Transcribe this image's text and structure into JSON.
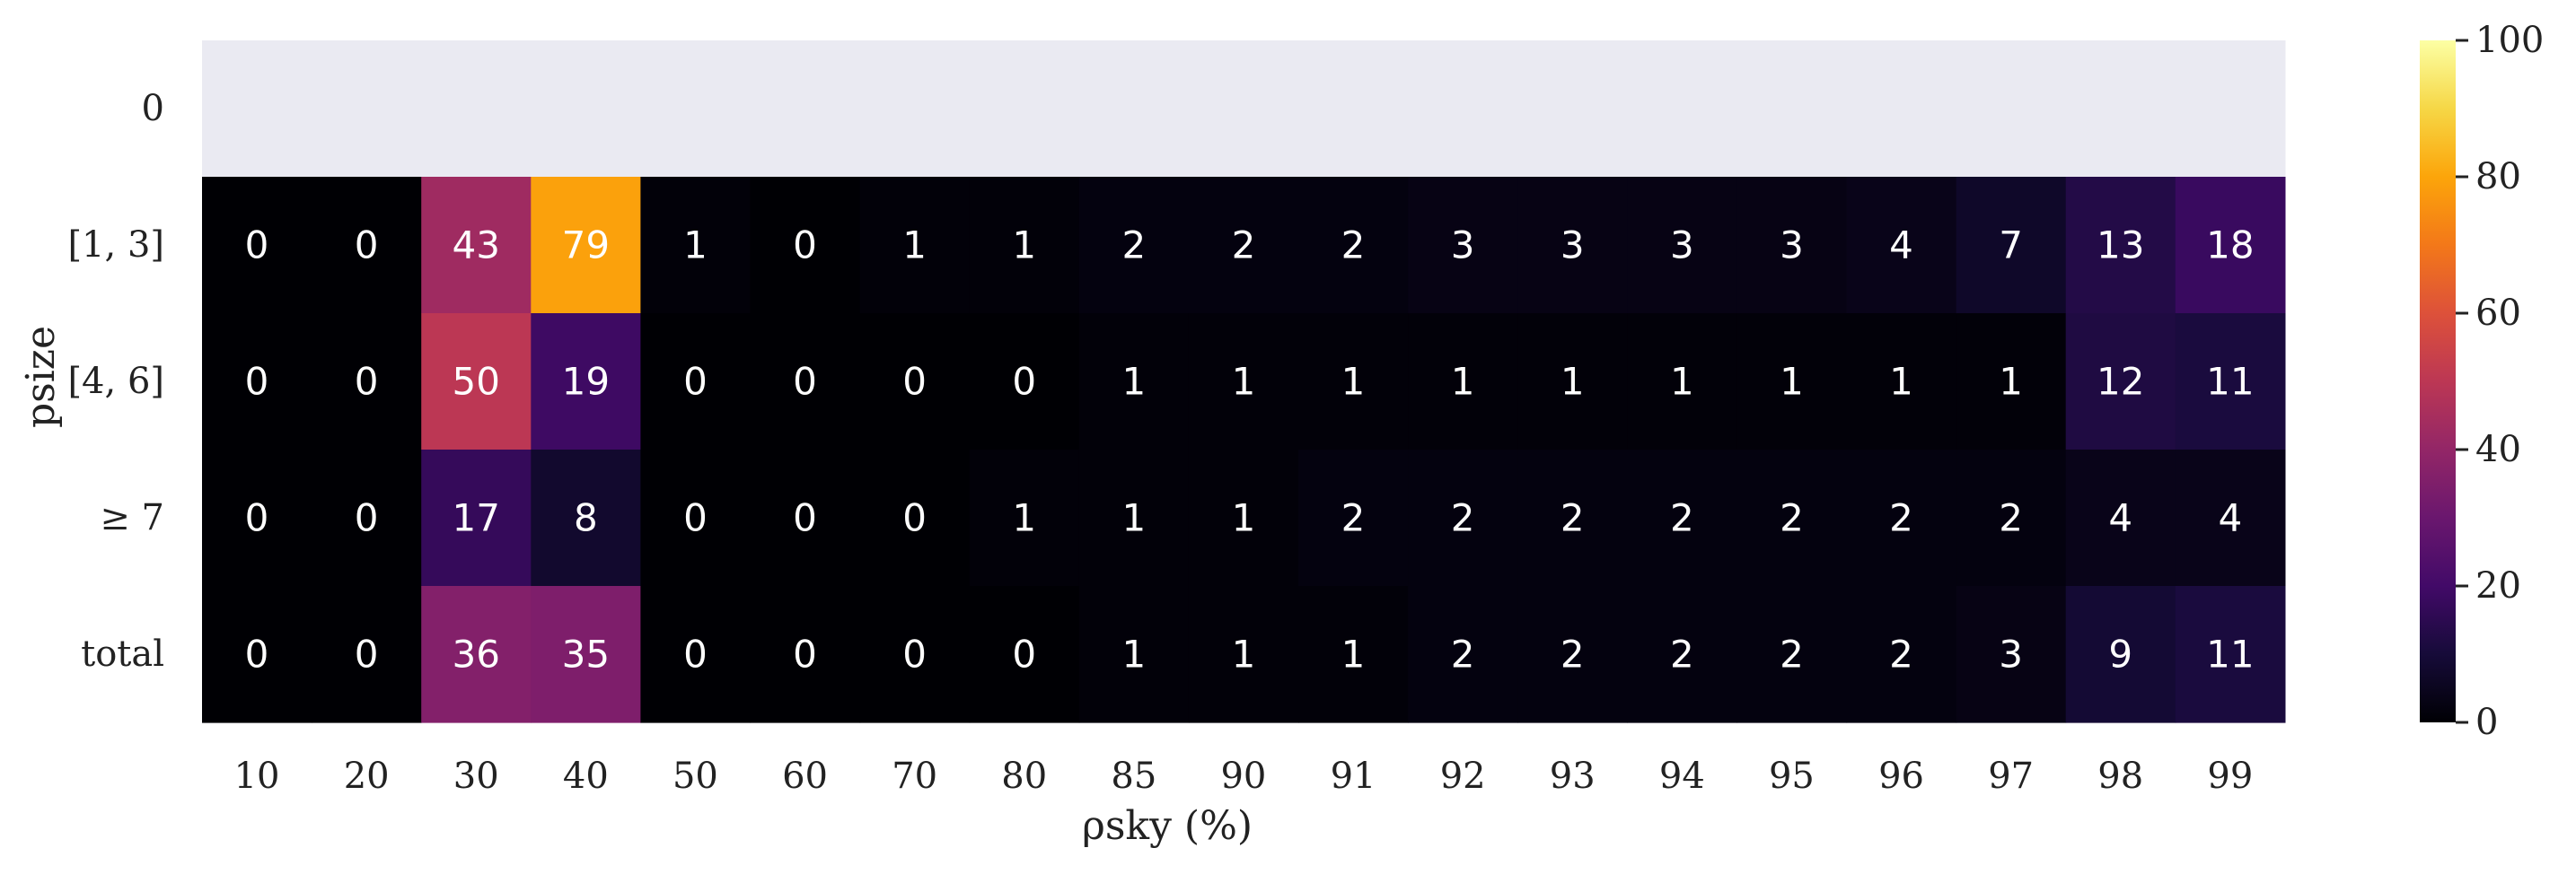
{
  "chart_data": {
    "type": "heatmap",
    "title": "",
    "xlabel": "ρsky (%)",
    "ylabel": "psize",
    "x_categories": [
      "10",
      "20",
      "30",
      "40",
      "50",
      "60",
      "70",
      "80",
      "85",
      "90",
      "91",
      "92",
      "93",
      "94",
      "95",
      "96",
      "97",
      "98",
      "99"
    ],
    "y_categories": [
      "0",
      "[1, 3]",
      "[4, 6]",
      "≥ 7",
      "total"
    ],
    "values": [
      [
        null,
        null,
        null,
        null,
        null,
        null,
        null,
        null,
        null,
        null,
        null,
        null,
        null,
        null,
        null,
        null,
        null,
        null,
        null
      ],
      [
        0,
        0,
        43,
        79,
        1,
        0,
        1,
        1,
        2,
        2,
        2,
        3,
        3,
        3,
        3,
        4,
        7,
        13,
        18
      ],
      [
        0,
        0,
        50,
        19,
        0,
        0,
        0,
        0,
        1,
        1,
        1,
        1,
        1,
        1,
        1,
        1,
        1,
        12,
        11
      ],
      [
        0,
        0,
        17,
        8,
        0,
        0,
        0,
        1,
        1,
        1,
        2,
        2,
        2,
        2,
        2,
        2,
        2,
        4,
        4
      ],
      [
        0,
        0,
        36,
        35,
        0,
        0,
        0,
        0,
        1,
        1,
        1,
        2,
        2,
        2,
        2,
        2,
        3,
        9,
        11
      ]
    ],
    "colormap": "inferno",
    "missing_color": "#eaeaf2",
    "vmin": 0,
    "vmax": 100,
    "colorbar_ticks": [
      "0",
      "20",
      "40",
      "60",
      "80",
      "100"
    ],
    "annotations": true
  }
}
